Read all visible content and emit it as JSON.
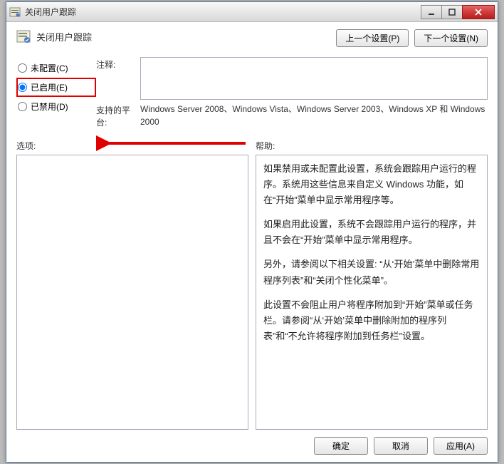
{
  "window": {
    "title": "关闭用户跟踪"
  },
  "header": {
    "policy_title": "关闭用户跟踪",
    "prev_btn": "上一个设置(P)",
    "next_btn": "下一个设置(N)"
  },
  "radios": {
    "not_configured": "未配置(C)",
    "enabled": "已启用(E)",
    "disabled": "已禁用(D)"
  },
  "info": {
    "comment_label": "注释:",
    "platform_label": "支持的平台:",
    "platform_text": "Windows Server 2008、Windows Vista、Windows Server 2003、Windows XP 和 Windows 2000"
  },
  "panels": {
    "options_label": "选项:",
    "help_label": "帮助:",
    "help_p1": "如果禁用或未配置此设置，系统会跟踪用户运行的程序。系统用这些信息来自定义 Windows 功能，如在“开始”菜单中显示常用程序等。",
    "help_p2": "如果启用此设置，系统不会跟踪用户运行的程序，并且不会在“开始”菜单中显示常用程序。",
    "help_p3": "另外，请参阅以下相关设置: “从‘开始’菜单中删除常用程序列表”和“关闭个性化菜单”。",
    "help_p4": "此设置不会阻止用户将程序附加到“开始”菜单或任务栏。请参阅“从‘开始’菜单中删除附加的程序列表”和“不允许将程序附加到任务栏”设置。"
  },
  "buttons": {
    "ok": "确定",
    "cancel": "取消",
    "apply": "应用(A)"
  }
}
